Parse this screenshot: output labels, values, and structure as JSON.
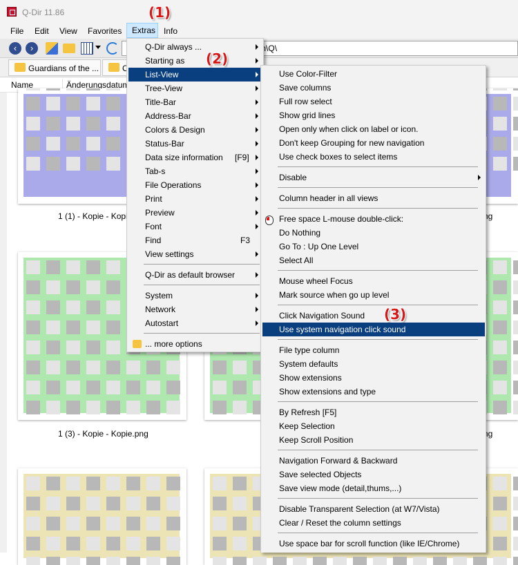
{
  "window": {
    "title": "Q-Dir 11.86"
  },
  "menubar": {
    "items": [
      {
        "label": "File",
        "underline": "F"
      },
      {
        "label": "Edit",
        "underline": "E"
      },
      {
        "label": "View",
        "underline": "V"
      },
      {
        "label": "Favorites",
        "underline": "a"
      },
      {
        "label": "Extras",
        "underline": "x"
      },
      {
        "label": "Info",
        "underline": ""
      }
    ]
  },
  "address": {
    "value": "g\\icon\\Q\\"
  },
  "tabs": [
    {
      "label": "Guardians of the ..."
    },
    {
      "label": "C"
    }
  ],
  "columns": {
    "name": "Name",
    "date": "Änderungsdatum"
  },
  "files": [
    {
      "label": "1 (1) - Kopie - Kopi"
    },
    {
      "label": "ng"
    },
    {
      "label": "1 (3) - Kopie - Kopie.png"
    },
    {
      "label": "ng"
    }
  ],
  "thumb_colors": {
    "blue": "#aaaaea",
    "green": "#aee8ae",
    "yellow": "#ece4b4",
    "gray": "#b8b8b8",
    "blank": "#e4e4e4"
  },
  "extras_menu": {
    "items": [
      {
        "label": "Q-Dir always ...",
        "submenu": true
      },
      {
        "label": "Starting as",
        "submenu": true
      },
      {
        "label": "List-View",
        "submenu": true,
        "highlighted": true
      },
      {
        "label": "Tree-View",
        "submenu": true
      },
      {
        "label": "Title-Bar",
        "submenu": true
      },
      {
        "label": "Address-Bar",
        "submenu": true
      },
      {
        "label": "Colors & Design",
        "submenu": true
      },
      {
        "label": "Status-Bar",
        "submenu": true
      },
      {
        "label": "Data size information",
        "shortcut": "[F9]",
        "submenu": true
      },
      {
        "label": "Tab-s",
        "submenu": true
      },
      {
        "label": "File Operations",
        "submenu": true
      },
      {
        "label": "Print",
        "submenu": true
      },
      {
        "label": "Preview",
        "submenu": true
      },
      {
        "label": "Font",
        "submenu": true
      },
      {
        "label": "Find",
        "shortcut": "F3"
      },
      {
        "label": "View settings",
        "submenu": true
      },
      {
        "label": "Q-Dir as default browser",
        "submenu": true
      },
      {
        "label": "System",
        "submenu": true
      },
      {
        "label": "Network",
        "submenu": true
      },
      {
        "label": "Autostart",
        "submenu": true
      },
      {
        "label": "... more options"
      }
    ]
  },
  "listview_menu": {
    "items": [
      {
        "label": "Use Color-Filter"
      },
      {
        "label": "Save columns"
      },
      {
        "label": "Full row select"
      },
      {
        "label": "Show grid lines"
      },
      {
        "label": "Open only when click on label or icon."
      },
      {
        "label": "Don't keep Grouping for new navigation"
      },
      {
        "label": "Use check boxes to select items"
      },
      {
        "label": "Disable",
        "submenu": true
      },
      {
        "label": "Column header in all views"
      },
      {
        "label": "Free space L-mouse double-click:"
      },
      {
        "label": "Do Nothing"
      },
      {
        "label": "Go To : Up One Level"
      },
      {
        "label": "Select All"
      },
      {
        "label": "Mouse wheel Focus"
      },
      {
        "label": "Mark source when go up level"
      },
      {
        "label": "Click Navigation Sound"
      },
      {
        "label": "Use system navigation click sound",
        "highlighted": true
      },
      {
        "label": "File type column"
      },
      {
        "label": "System defaults"
      },
      {
        "label": "Show extensions"
      },
      {
        "label": "Show extensions and type"
      },
      {
        "label": "By Refresh [F5]"
      },
      {
        "label": "Keep Selection"
      },
      {
        "label": "Keep Scroll Position"
      },
      {
        "label": "Navigation Forward & Backward"
      },
      {
        "label": "Save selected Objects"
      },
      {
        "label": "Save view mode (detail,thums,...)"
      },
      {
        "label": "Disable Transparent Selection (at W7/Vista)"
      },
      {
        "label": "Clear / Reset the column settings"
      },
      {
        "label": "Use space bar for scroll function (like IE/Chrome)"
      }
    ]
  },
  "annotations": [
    "(1)",
    "(2)",
    "(3)"
  ]
}
